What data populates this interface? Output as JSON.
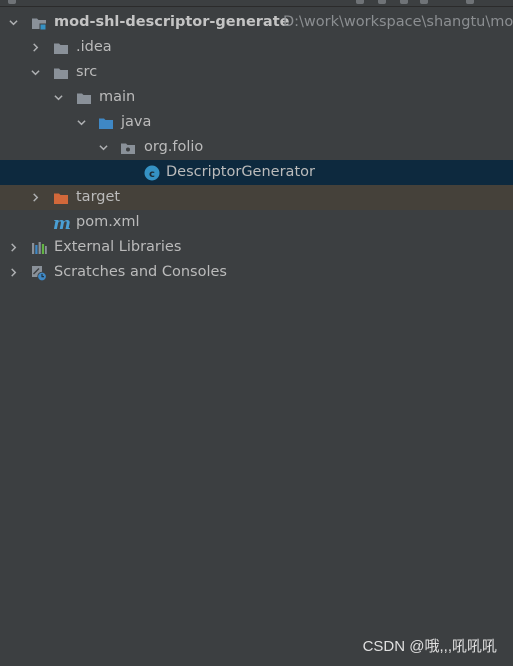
{
  "tree": {
    "root": {
      "name": "mod-shl-descriptor-generate",
      "path": "D:\\work\\workspace\\shangtu\\mo"
    },
    "idea": {
      "name": ".idea"
    },
    "src": {
      "name": "src"
    },
    "main": {
      "name": "main"
    },
    "java": {
      "name": "java"
    },
    "package": {
      "name": "org.folio"
    },
    "class_file": {
      "name": "DescriptorGenerator"
    },
    "target": {
      "name": "target"
    },
    "pom": {
      "name": "pom.xml"
    },
    "external_libraries": {
      "name": "External Libraries"
    },
    "scratches": {
      "name": "Scratches and Consoles"
    }
  },
  "colors": {
    "panel_bg": "#3c3f41",
    "selection_bg": "#0d293e",
    "excluded_bg": "#45413a",
    "folder_gray": "#8a9199",
    "folder_blue": "#3f88c5",
    "folder_orange": "#d2683a",
    "class_icon": "#3592c4",
    "maven_icon": "#4a9fd4"
  },
  "icons": {
    "module": "module-folder-icon",
    "folder": "folder-icon",
    "source_folder": "source-folder-icon",
    "package": "package-icon",
    "class": "java-class-icon",
    "excluded_folder": "excluded-folder-icon",
    "maven": "maven-icon",
    "libraries": "libraries-icon",
    "scratches": "scratches-icon"
  },
  "watermark": "CSDN @哦,,,吼吼吼"
}
